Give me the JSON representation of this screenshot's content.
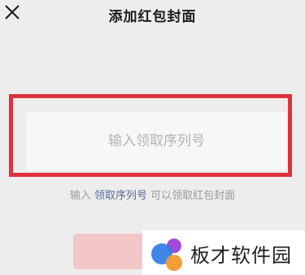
{
  "header": {
    "title": "添加红包封面",
    "close_icon": "close-icon"
  },
  "form": {
    "input_placeholder": "输入领取序列号",
    "input_value": ""
  },
  "hint": {
    "prefix": "输入 ",
    "link": "领取序列号",
    "suffix": " 可以领取红包封面"
  },
  "confirm_button": {
    "label": ""
  },
  "watermark": {
    "text": "板才软件园"
  },
  "colors": {
    "highlight_border": "#e0313b",
    "link": "#576b95",
    "button_disabled": "#f3c7c7",
    "background": "#ededed"
  }
}
